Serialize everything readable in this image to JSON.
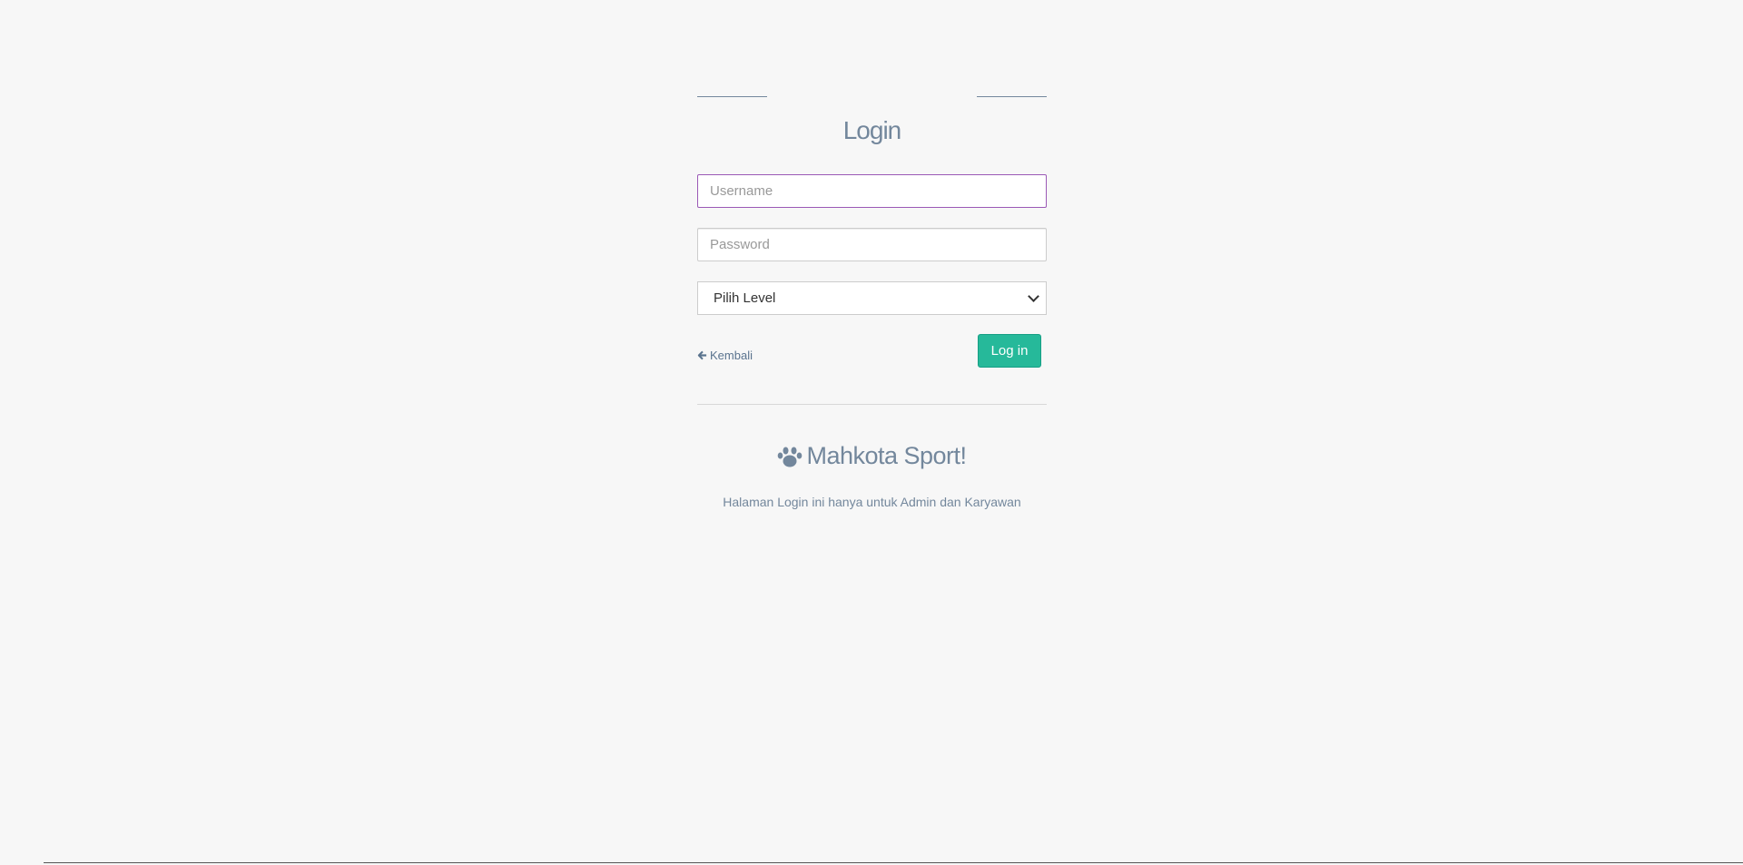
{
  "login": {
    "title": "Login",
    "username_placeholder": "Username",
    "password_placeholder": "Password",
    "level_select": {
      "selected": "Pilih Level",
      "options": [
        "Pilih Level"
      ]
    },
    "back_label": "Kembali",
    "submit_label": "Log in"
  },
  "brand": {
    "name": "Mahkota Sport!",
    "icon": "paw-icon"
  },
  "note": "Halaman Login ini hanya untuk Admin dan Karyawan",
  "colors": {
    "background": "#f7f7f7",
    "text": "#73879c",
    "primary_button": "#26b99a",
    "focus_border": "#9b59b6"
  }
}
